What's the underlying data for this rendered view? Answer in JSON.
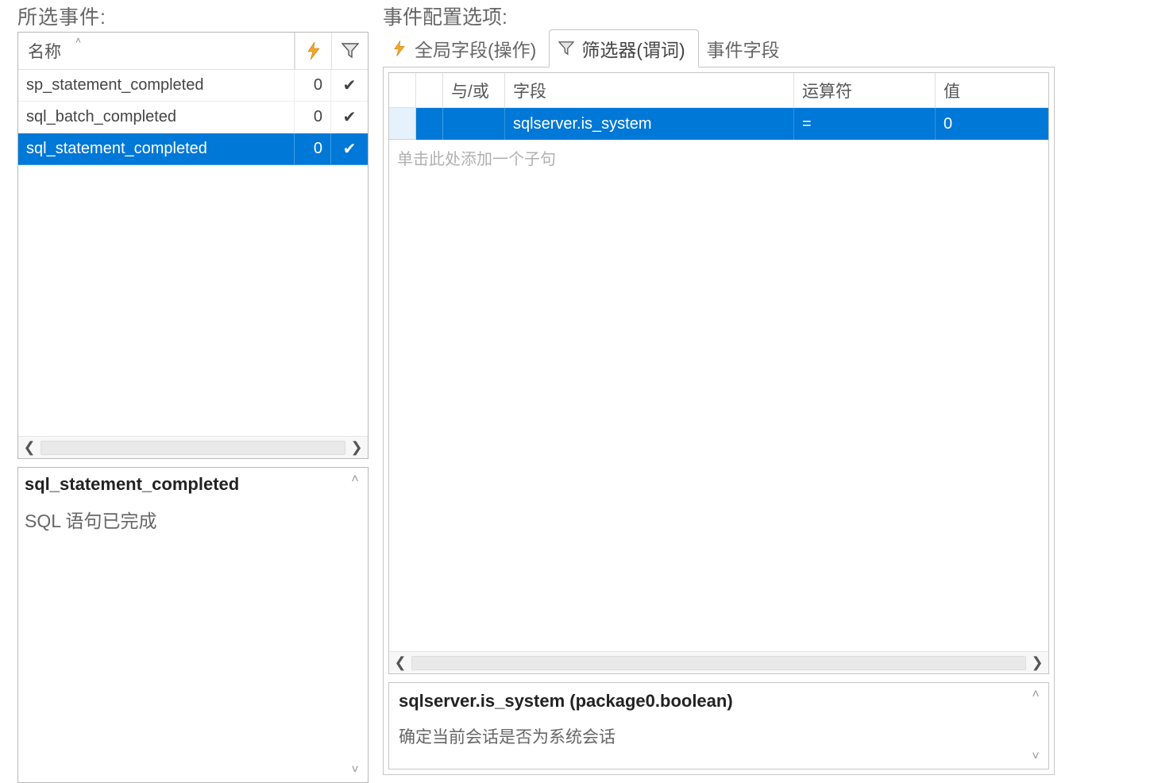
{
  "left": {
    "title": "所选事件:",
    "columns": {
      "name": "名称"
    },
    "rows": [
      {
        "name": "sp_statement_completed",
        "count": "0",
        "flag": "✔",
        "selected": false
      },
      {
        "name": "sql_batch_completed",
        "count": "0",
        "flag": "✔",
        "selected": false
      },
      {
        "name": "sql_statement_completed",
        "count": "0",
        "flag": "✔",
        "selected": true
      }
    ],
    "desc": {
      "title": "sql_statement_completed",
      "text": "SQL 语句已完成"
    }
  },
  "right": {
    "title": "事件配置选项:",
    "tabs": [
      {
        "id": "global",
        "label": "全局字段(操作)",
        "icon": "bolt",
        "active": false
      },
      {
        "id": "filter",
        "label": "筛选器(谓词)",
        "icon": "funnel",
        "active": true
      },
      {
        "id": "fields",
        "label": "事件字段",
        "icon": "",
        "active": false
      }
    ],
    "filter": {
      "headers": {
        "andor": "与/或",
        "field": "字段",
        "op": "运算符",
        "value": "值"
      },
      "rows": [
        {
          "andor": "",
          "field": "sqlserver.is_system",
          "op": "=",
          "value": "0"
        }
      ],
      "placeholder": "单击此处添加一个子句"
    },
    "field_desc": {
      "title": "sqlserver.is_system (package0.boolean)",
      "text": "确定当前会话是否为系统会话"
    }
  },
  "glyphs": {
    "caret_up": "˄",
    "check": "✔",
    "left": "❮",
    "right": "❯",
    "up": "˄",
    "down": "˅"
  }
}
